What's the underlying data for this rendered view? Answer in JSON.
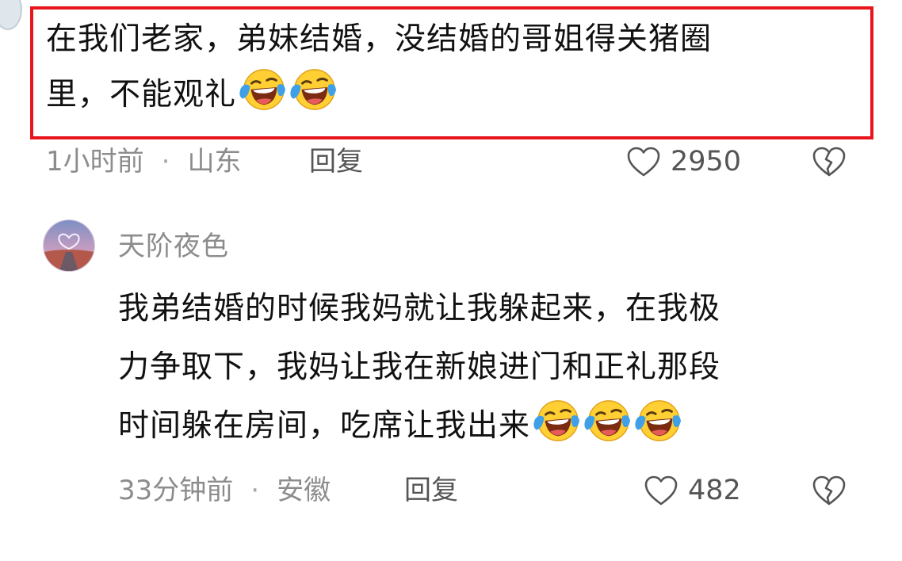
{
  "comment1": {
    "text_line1": "在我们老家，弟妹结婚，没结婚的哥姐得关猪圈",
    "text_line2": "里，不能观礼",
    "emoji": [
      "loudly-laughing-face",
      "loudly-laughing-face"
    ],
    "time": "1小时前",
    "location": "山东",
    "reply": "回复",
    "likes": "2950"
  },
  "comment2": {
    "username": "天阶夜色",
    "text_line1": "我弟结婚的时候我妈就让我躲起来，在我极",
    "text_line2": "力争取下，我妈让我在新娘进门和正礼那段",
    "text_line3": "时间躲在房间，吃席让我出来",
    "emoji": [
      "loudly-laughing-face",
      "loudly-laughing-face",
      "loudly-laughing-face"
    ],
    "time": "33分钟前",
    "location": "安徽",
    "reply": "回复",
    "likes": "482"
  },
  "meta_separator": "·",
  "colors": {
    "highlight_border": "#e8151e",
    "meta_text": "#8c8c8c",
    "emoji_face": "#ffcf33",
    "emoji_tears": "#3fa0e8"
  }
}
